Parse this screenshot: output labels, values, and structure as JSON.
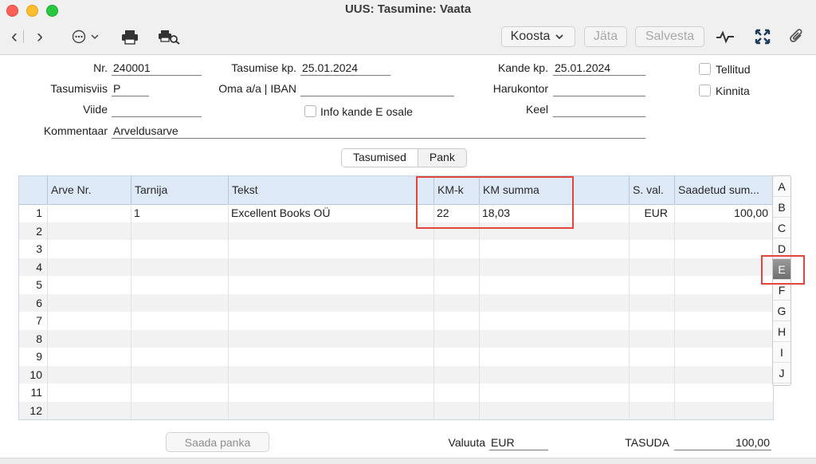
{
  "window": {
    "title": "UUS: Tasumine: Vaata"
  },
  "toolbar": {
    "back_glyph": "‹",
    "forward_glyph": "›",
    "more_glyph": "⋯",
    "koosta_label": "Koosta",
    "jata_label": "Jäta",
    "salvesta_label": "Salvesta"
  },
  "form": {
    "nr_label": "Nr.",
    "nr_value": "240001",
    "tasumise_kp_label": "Tasumise kp.",
    "tasumise_kp_value": "25.01.2024",
    "kande_kp_label": "Kande kp.",
    "kande_kp_value": "25.01.2024",
    "tasumisviis_label": "Tasumisviis",
    "tasumisviis_value": "P",
    "oma_iban_label": "Oma a/a | IBAN",
    "oma_iban_value": "",
    "harukontor_label": "Harukontor",
    "harukontor_value": "",
    "viide_label": "Viide",
    "viide_value": "",
    "info_label": "Info kande E osale",
    "keel_label": "Keel",
    "keel_value": "",
    "kommentaar_label": "Kommentaar",
    "kommentaar_value": "Arveldusarve",
    "tellitud_label": "Tellitud",
    "kinnita_label": "Kinnita"
  },
  "tabs": {
    "tasumised": "Tasumised",
    "pank": "Pank"
  },
  "table": {
    "headers": [
      "Arve Nr.",
      "Tarnija",
      "Tekst",
      "KM-k",
      "KM summa",
      "S. val.",
      "Saadetud sum..."
    ],
    "rows": [
      {
        "n": "1",
        "arve": "",
        "tarnija": "1",
        "tekst": "Excellent Books OÜ",
        "kmk": "22",
        "kmsumma": "18,03",
        "val": "EUR",
        "saadetud": "100,00"
      },
      {
        "n": "2",
        "arve": "",
        "tarnija": "",
        "tekst": "",
        "kmk": "",
        "kmsumma": "",
        "val": "",
        "saadetud": ""
      },
      {
        "n": "3",
        "arve": "",
        "tarnija": "",
        "tekst": "",
        "kmk": "",
        "kmsumma": "",
        "val": "",
        "saadetud": ""
      },
      {
        "n": "4",
        "arve": "",
        "tarnija": "",
        "tekst": "",
        "kmk": "",
        "kmsumma": "",
        "val": "",
        "saadetud": ""
      },
      {
        "n": "5",
        "arve": "",
        "tarnija": "",
        "tekst": "",
        "kmk": "",
        "kmsumma": "",
        "val": "",
        "saadetud": ""
      },
      {
        "n": "6",
        "arve": "",
        "tarnija": "",
        "tekst": "",
        "kmk": "",
        "kmsumma": "",
        "val": "",
        "saadetud": ""
      },
      {
        "n": "7",
        "arve": "",
        "tarnija": "",
        "tekst": "",
        "kmk": "",
        "kmsumma": "",
        "val": "",
        "saadetud": ""
      },
      {
        "n": "8",
        "arve": "",
        "tarnija": "",
        "tekst": "",
        "kmk": "",
        "kmsumma": "",
        "val": "",
        "saadetud": ""
      },
      {
        "n": "9",
        "arve": "",
        "tarnija": "",
        "tekst": "",
        "kmk": "",
        "kmsumma": "",
        "val": "",
        "saadetud": ""
      },
      {
        "n": "10",
        "arve": "",
        "tarnija": "",
        "tekst": "",
        "kmk": "",
        "kmsumma": "",
        "val": "",
        "saadetud": ""
      },
      {
        "n": "11",
        "arve": "",
        "tarnija": "",
        "tekst": "",
        "kmk": "",
        "kmsumma": "",
        "val": "",
        "saadetud": ""
      },
      {
        "n": "12",
        "arve": "",
        "tarnija": "",
        "tekst": "",
        "kmk": "",
        "kmsumma": "",
        "val": "",
        "saadetud": ""
      }
    ]
  },
  "letters": [
    "A",
    "B",
    "C",
    "D",
    "E",
    "F",
    "G",
    "H",
    "I",
    "J"
  ],
  "selected_letter": "E",
  "footer": {
    "saada_panka": "Saada panka",
    "valuuta_label": "Valuuta",
    "valuuta_value": "EUR",
    "tasuda_label": "TASUDA",
    "tasuda_value": "100,00"
  },
  "colors": {
    "highlight": "#e0463a",
    "header_bg": "#dde9f6"
  }
}
